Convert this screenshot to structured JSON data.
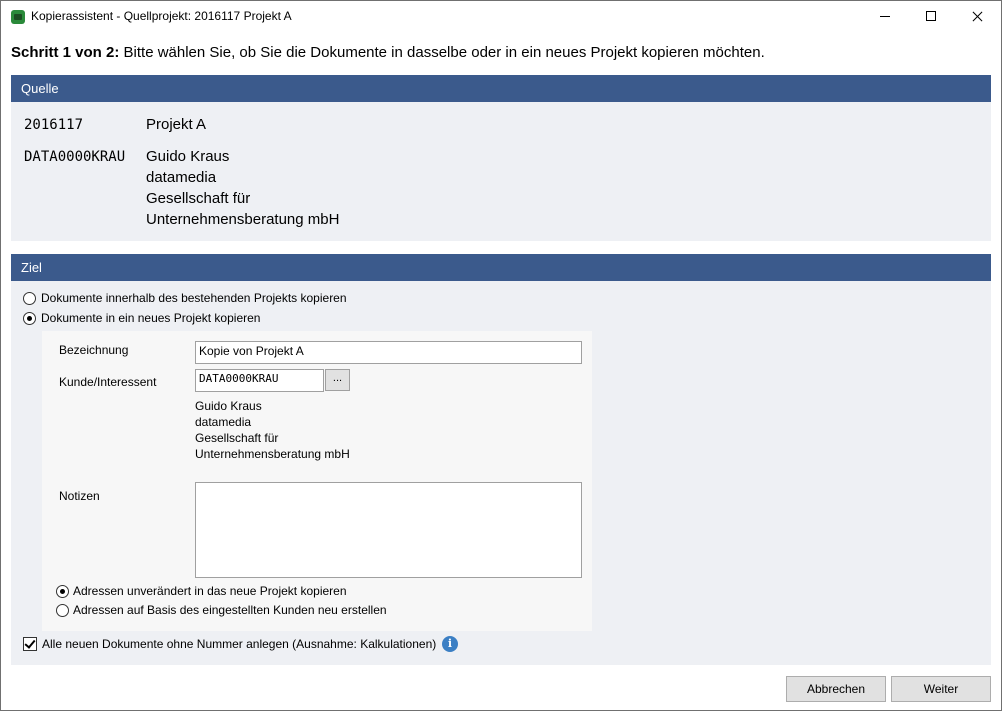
{
  "window": {
    "title": "Kopierassistent - Quellprojekt: 2016117 Projekt A"
  },
  "step": {
    "bold": "Schritt 1 von 2:",
    "text": " Bitte wählen Sie, ob Sie die Dokumente in dasselbe oder in ein neues Projekt kopieren möchten."
  },
  "quelle": {
    "header": "Quelle",
    "project_number": "2016117",
    "project_name": "Projekt A",
    "customer_code": "DATA0000KRAU",
    "customer_lines": [
      "Guido Kraus",
      "datamedia",
      "Gesellschaft für",
      "Unternehmensberatung mbH"
    ]
  },
  "ziel": {
    "header": "Ziel",
    "options": [
      {
        "label": "Dokumente innerhalb des bestehenden Projekts kopieren",
        "checked": false
      },
      {
        "label": "Dokumente in ein neues Projekt kopieren",
        "checked": true
      }
    ],
    "bezeichnung_label": "Bezeichnung",
    "bezeichnung_value": "Kopie von Projekt A",
    "kunde_label": "Kunde/Interessent",
    "kunde_value": "DATA0000KRAU",
    "browse_label": "...",
    "kunde_lines": [
      "Guido Kraus",
      "datamedia",
      "Gesellschaft für",
      "Unternehmensberatung mbH"
    ],
    "notizen_label": "Notizen",
    "notizen_value": "",
    "address_options": [
      {
        "label": "Adressen unverändert in das neue Projekt kopieren",
        "checked": true
      },
      {
        "label": "Adressen auf Basis des eingestellten Kunden neu erstellen",
        "checked": false
      }
    ],
    "checkbox_label": "Alle neuen Dokumente ohne Nummer anlegen (Ausnahme: Kalkulationen)",
    "checkbox_checked": true,
    "info_icon": "info-icon"
  },
  "footer": {
    "cancel_label": "Abbrechen",
    "next_label": "Weiter"
  }
}
